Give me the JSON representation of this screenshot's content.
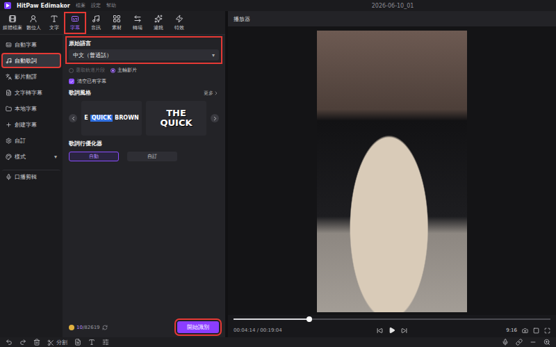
{
  "window": {
    "app_name": "HitPaw Edimakor",
    "menu": [
      "檔案",
      "設定",
      "幫助"
    ],
    "project": "2026-06-10_01"
  },
  "toolbar": [
    {
      "label": "媒體檔案",
      "selected": false,
      "annotated": false
    },
    {
      "label": "數位人",
      "selected": false,
      "annotated": false
    },
    {
      "label": "文字",
      "selected": false,
      "annotated": false
    },
    {
      "label": "字幕",
      "selected": true,
      "annotated": true
    },
    {
      "label": "音訊",
      "selected": false,
      "annotated": false
    },
    {
      "label": "素材",
      "selected": false,
      "annotated": false
    },
    {
      "label": "轉場",
      "selected": false,
      "annotated": false
    },
    {
      "label": "濾鏡",
      "selected": false,
      "annotated": false
    },
    {
      "label": "特效",
      "selected": false,
      "annotated": false
    }
  ],
  "sidebar": [
    {
      "label": "自動字幕",
      "selected": false,
      "annotated": false,
      "suffix": "",
      "divider_before": false
    },
    {
      "label": "自動歌詞",
      "selected": true,
      "annotated": true,
      "suffix": "",
      "divider_before": false
    },
    {
      "label": "影片翻譯",
      "selected": false,
      "annotated": false,
      "suffix": "",
      "divider_before": false
    },
    {
      "label": "文字轉字幕",
      "selected": false,
      "annotated": false,
      "suffix": "",
      "divider_before": false
    },
    {
      "label": "本地字幕",
      "selected": false,
      "annotated": false,
      "suffix": "",
      "divider_before": false
    },
    {
      "label": "創建字幕",
      "selected": false,
      "annotated": false,
      "suffix": "",
      "divider_before": false
    },
    {
      "label": "自訂",
      "selected": false,
      "annotated": false,
      "suffix": "",
      "divider_before": false
    },
    {
      "label": "樣式",
      "selected": false,
      "annotated": false,
      "suffix": "▾",
      "divider_before": false
    },
    {
      "label": "口播剪輯",
      "selected": false,
      "annotated": false,
      "suffix": "",
      "divider_before": true
    }
  ],
  "panel": {
    "language": {
      "label": "原始語言",
      "value": "中文（普通話）",
      "caret": "▾",
      "annotated": true
    },
    "source_options": [
      {
        "label": "選取軌道片段",
        "selected": false,
        "disabled": true
      },
      {
        "label": "主軸影片",
        "selected": true,
        "disabled": false
      }
    ],
    "clear_existing": {
      "label": "清空已有字幕",
      "checked": true
    },
    "lyric_style": {
      "label": "歌詞風格",
      "more": "更多",
      "styles": [
        {
          "kind": "highlight",
          "words": [
            "E",
            "QUICK",
            "BROWN"
          ],
          "highlight_index": 1,
          "selected": false
        },
        {
          "kind": "stacked",
          "words": [
            "THE",
            "QUICK"
          ],
          "highlight_index": -1,
          "selected": false
        }
      ]
    },
    "optimizer": {
      "label": "歌詞行優化器",
      "options": [
        {
          "label": "自動",
          "selected": true
        },
        {
          "label": "自訂",
          "selected": false
        }
      ]
    },
    "credits": {
      "used": "10",
      "separator": "/",
      "total": "82619"
    },
    "start": {
      "label": "開始識別",
      "annotated": true
    }
  },
  "player": {
    "title": "播放器",
    "time_current": "00:04:14",
    "time_separator": "/",
    "time_total": "00:19:04",
    "level": 0.24,
    "aspect": "9:16"
  },
  "bottom_toolbar": {
    "split": "分割"
  }
}
